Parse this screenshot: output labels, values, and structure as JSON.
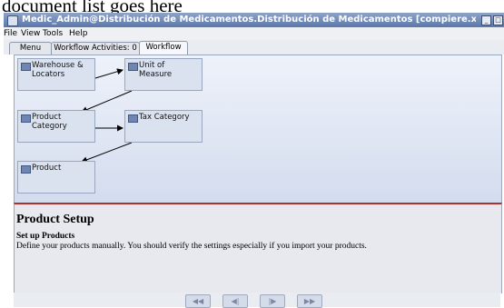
{
  "doc_background_text": "document list goes here",
  "window": {
    "title": "Medic_Admin@Distribución de Medicamentos.Distribución de Medicamentos [compiere.xim.co",
    "buttons": [
      "_",
      "□"
    ]
  },
  "menu": {
    "file": "File",
    "view": "View",
    "tools": "Tools",
    "help": "Help"
  },
  "tabs": [
    {
      "label": "Menu"
    },
    {
      "label": "Workflow Activities: 0"
    },
    {
      "label": "Workflow"
    }
  ],
  "workflow": {
    "nodes": [
      {
        "label": "Warehouse & Locators"
      },
      {
        "label": "Unit of Measure"
      },
      {
        "label": "Product Category"
      },
      {
        "label": "Tax Category"
      },
      {
        "label": "Product"
      }
    ]
  },
  "help": {
    "title": "Product Setup",
    "subtitle": "Set up Products",
    "description": "Define your products manually. You should verify the settings especially if you import your products."
  },
  "nav": {
    "buttons": [
      "◀◀",
      "◀|",
      "|▶",
      "▶▶"
    ]
  }
}
